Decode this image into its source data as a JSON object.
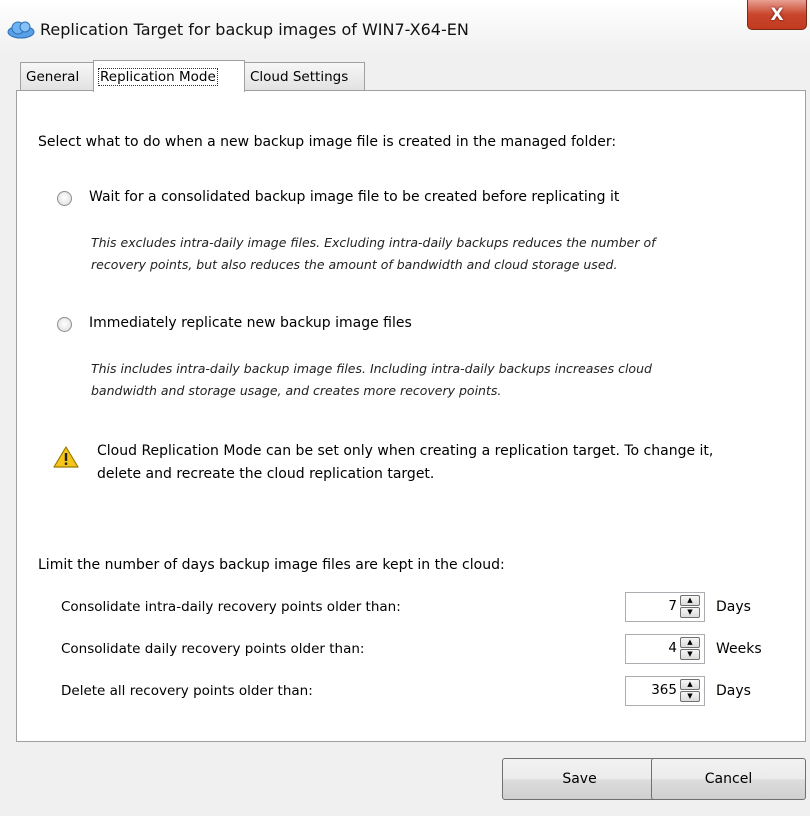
{
  "window": {
    "title": "Replication Target for backup images of WIN7-X64-EN",
    "close_glyph": "X"
  },
  "tabs": [
    {
      "label": "General"
    },
    {
      "label": "Replication Mode"
    },
    {
      "label": "Cloud Settings"
    }
  ],
  "mode": {
    "prompt": "Select what to do when a new backup image file is created in the managed folder:",
    "options": [
      {
        "label": "Wait for a consolidated backup image file to be created before replicating it",
        "desc_line1": "This excludes intra-daily image files. Excluding intra-daily backups reduces the number of",
        "desc_line2": "recovery points, but also reduces the amount of bandwidth and cloud storage used."
      },
      {
        "label": "Immediately replicate new backup image files",
        "desc_line1": "This includes intra-daily backup image files. Including intra-daily backups increases cloud",
        "desc_line2": "bandwidth and storage usage, and creates more recovery points."
      }
    ],
    "warning_line1": "Cloud Replication Mode can be set only when creating a replication target. To change it,",
    "warning_line2": "delete and recreate the cloud replication target."
  },
  "retention": {
    "heading": "Limit the number of days backup image files are kept in the cloud:",
    "rows": [
      {
        "label": "Consolidate intra-daily recovery points older than:",
        "value": "7",
        "unit": "Days"
      },
      {
        "label": "Consolidate daily recovery points older than:",
        "value": "4",
        "unit": "Weeks"
      },
      {
        "label": "Delete all recovery points older than:",
        "value": "365",
        "unit": "Days"
      }
    ]
  },
  "buttons": {
    "save": "Save",
    "cancel": "Cancel"
  },
  "colors": {
    "close_button": "#c9462c",
    "warning_icon": "#f5c518"
  }
}
